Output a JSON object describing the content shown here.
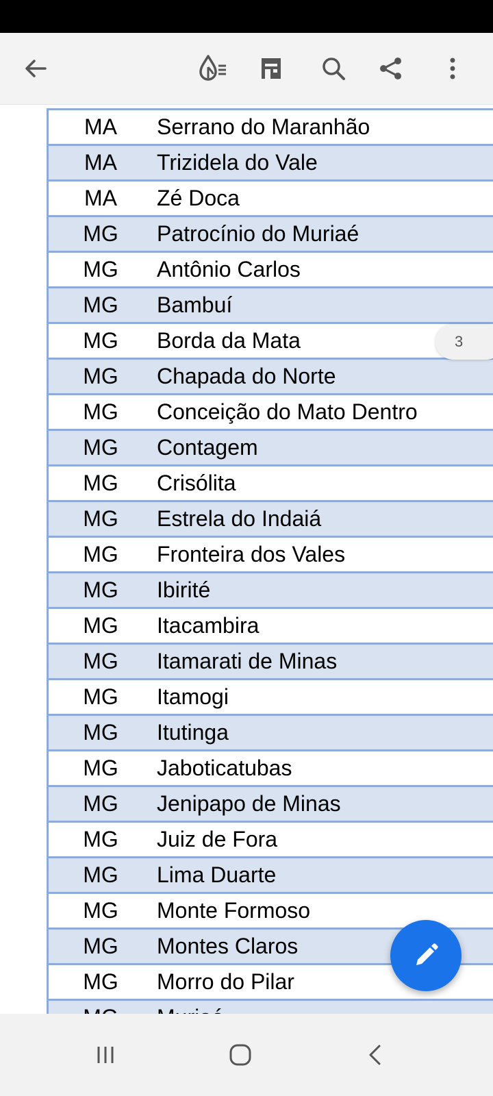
{
  "toolbar": {
    "icons": [
      "back-arrow-icon",
      "reading-mode-icon",
      "page-layout-icon",
      "search-icon",
      "share-icon",
      "more-options-icon"
    ]
  },
  "table": {
    "rows": [
      {
        "state": "MA",
        "city": "Serrano do Maranhão"
      },
      {
        "state": "MA",
        "city": "Trizidela do Vale"
      },
      {
        "state": "MA",
        "city": "Zé Doca"
      },
      {
        "state": "MG",
        "city": "Patrocínio do Muriaé"
      },
      {
        "state": "MG",
        "city": "Antônio Carlos"
      },
      {
        "state": "MG",
        "city": "Bambuí"
      },
      {
        "state": "MG",
        "city": "Borda da Mata"
      },
      {
        "state": "MG",
        "city": "Chapada do Norte"
      },
      {
        "state": "MG",
        "city": "Conceição do Mato Dentro"
      },
      {
        "state": "MG",
        "city": "Contagem"
      },
      {
        "state": "MG",
        "city": "Crisólita"
      },
      {
        "state": "MG",
        "city": "Estrela do Indaiá"
      },
      {
        "state": "MG",
        "city": "Fronteira dos Vales"
      },
      {
        "state": "MG",
        "city": "Ibirité"
      },
      {
        "state": "MG",
        "city": "Itacambira"
      },
      {
        "state": "MG",
        "city": "Itamarati de Minas"
      },
      {
        "state": "MG",
        "city": "Itamogi"
      },
      {
        "state": "MG",
        "city": "Itutinga"
      },
      {
        "state": "MG",
        "city": "Jaboticatubas"
      },
      {
        "state": "MG",
        "city": "Jenipapo de Minas"
      },
      {
        "state": "MG",
        "city": "Juiz de Fora"
      },
      {
        "state": "MG",
        "city": "Lima Duarte"
      },
      {
        "state": "MG",
        "city": "Monte Formoso"
      },
      {
        "state": "MG",
        "city": "Montes Claros"
      },
      {
        "state": "MG",
        "city": "Morro do Pilar"
      },
      {
        "state": "MG",
        "city": "Muriaé"
      }
    ]
  },
  "page_indicator": {
    "value": "3"
  },
  "fab": {
    "icon": "edit-pencil-icon",
    "color": "#1a73e8"
  },
  "nav_bar": {
    "icons": [
      "recent-apps-icon",
      "home-icon",
      "back-icon"
    ]
  },
  "colors": {
    "table_border": "#8eaadb",
    "row_shade": "#d9e2f0"
  }
}
